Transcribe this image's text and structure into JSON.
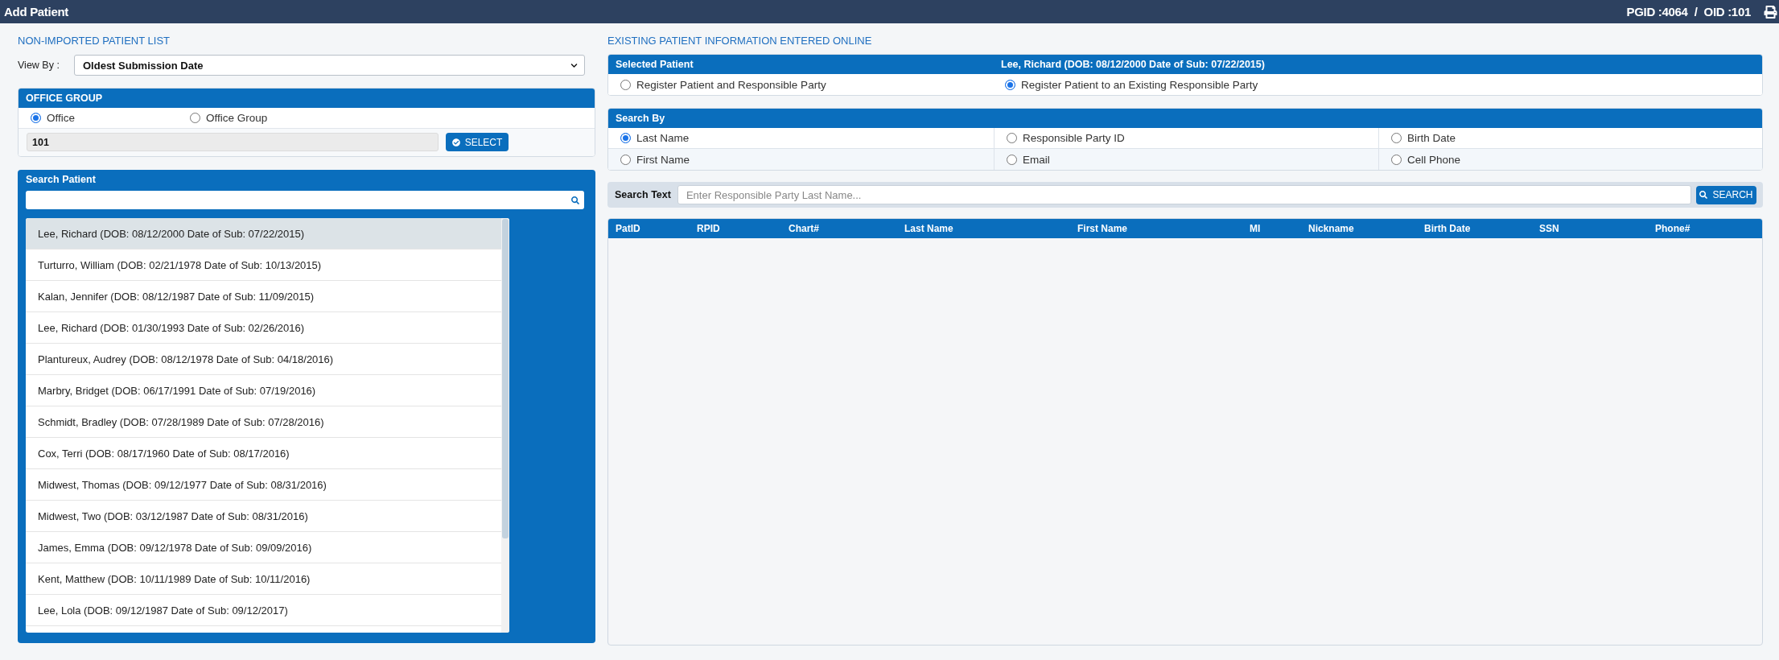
{
  "header": {
    "title": "Add Patient",
    "ids": [
      "PGID :4064",
      "/",
      "OID :101"
    ]
  },
  "patient_list": {
    "title": "NON-IMPORTED PATIENT LIST",
    "view_by": {
      "label": "View By :",
      "value": "Oldest Submission Date"
    },
    "office_group": {
      "title": "OFFICE GROUP",
      "options": [
        {
          "label": "Office",
          "selected": true
        },
        {
          "label": "Office Group",
          "selected": false
        }
      ],
      "value": "101",
      "button": "SELECT"
    },
    "search_patient": {
      "title": "Search Patient",
      "patients": [
        {
          "label": "Lee, Richard (DOB: 08/12/2000 Date of Sub: 07/22/2015)",
          "selected": true
        },
        {
          "label": "Turturro, William (DOB: 02/21/1978 Date of Sub: 10/13/2015)",
          "selected": false
        },
        {
          "label": "Kalan, Jennifer (DOB: 08/12/1987 Date of Sub: 11/09/2015)",
          "selected": false
        },
        {
          "label": "Lee, Richard (DOB: 01/30/1993 Date of Sub: 02/26/2016)",
          "selected": false
        },
        {
          "label": "Plantureux, Audrey (DOB: 08/12/1978 Date of Sub: 04/18/2016)",
          "selected": false
        },
        {
          "label": "Marbry, Bridget (DOB: 06/17/1991 Date of Sub: 07/19/2016)",
          "selected": false
        },
        {
          "label": "Schmidt, Bradley (DOB: 07/28/1989 Date of Sub: 07/28/2016)",
          "selected": false
        },
        {
          "label": "Cox, Terri (DOB: 08/17/1960 Date of Sub: 08/17/2016)",
          "selected": false
        },
        {
          "label": "Midwest, Thomas (DOB: 09/12/1977 Date of Sub: 08/31/2016)",
          "selected": false
        },
        {
          "label": "Midwest, Two (DOB: 03/12/1987 Date of Sub: 08/31/2016)",
          "selected": false
        },
        {
          "label": "James, Emma (DOB: 09/12/1978 Date of Sub: 09/09/2016)",
          "selected": false
        },
        {
          "label": "Kent, Matthew (DOB: 10/11/1989 Date of Sub: 10/11/2016)",
          "selected": false
        },
        {
          "label": "Lee, Lola (DOB: 09/12/1987 Date of Sub: 09/12/2017)",
          "selected": false
        }
      ]
    }
  },
  "existing_patient": {
    "title": "EXISTING PATIENT INFORMATION ENTERED ONLINE",
    "selected_patient": {
      "label": "Selected Patient",
      "value": "Lee, Richard (DOB: 08/12/2000 Date of Sub: 07/22/2015)",
      "options": [
        {
          "label": "Register Patient and Responsible Party",
          "selected": false
        },
        {
          "label": "Register Patient to an Existing Responsible Party",
          "selected": true
        }
      ]
    },
    "search_by": {
      "title": "Search By",
      "options": [
        {
          "label": "Last Name",
          "selected": true
        },
        {
          "label": "Responsible Party ID",
          "selected": false
        },
        {
          "label": "Birth Date",
          "selected": false
        },
        {
          "label": "First Name",
          "selected": false
        },
        {
          "label": "Email",
          "selected": false
        },
        {
          "label": "Cell Phone",
          "selected": false
        }
      ]
    },
    "search_text": {
      "label": "Search Text",
      "placeholder": "Enter Responsible Party Last Name...",
      "button": "SEARCH"
    },
    "table": {
      "columns": [
        "PatID",
        "RPID",
        "Chart#",
        "Last Name",
        "First Name",
        "MI",
        "Nickname",
        "Birth Date",
        "SSN",
        "Phone#"
      ]
    }
  }
}
